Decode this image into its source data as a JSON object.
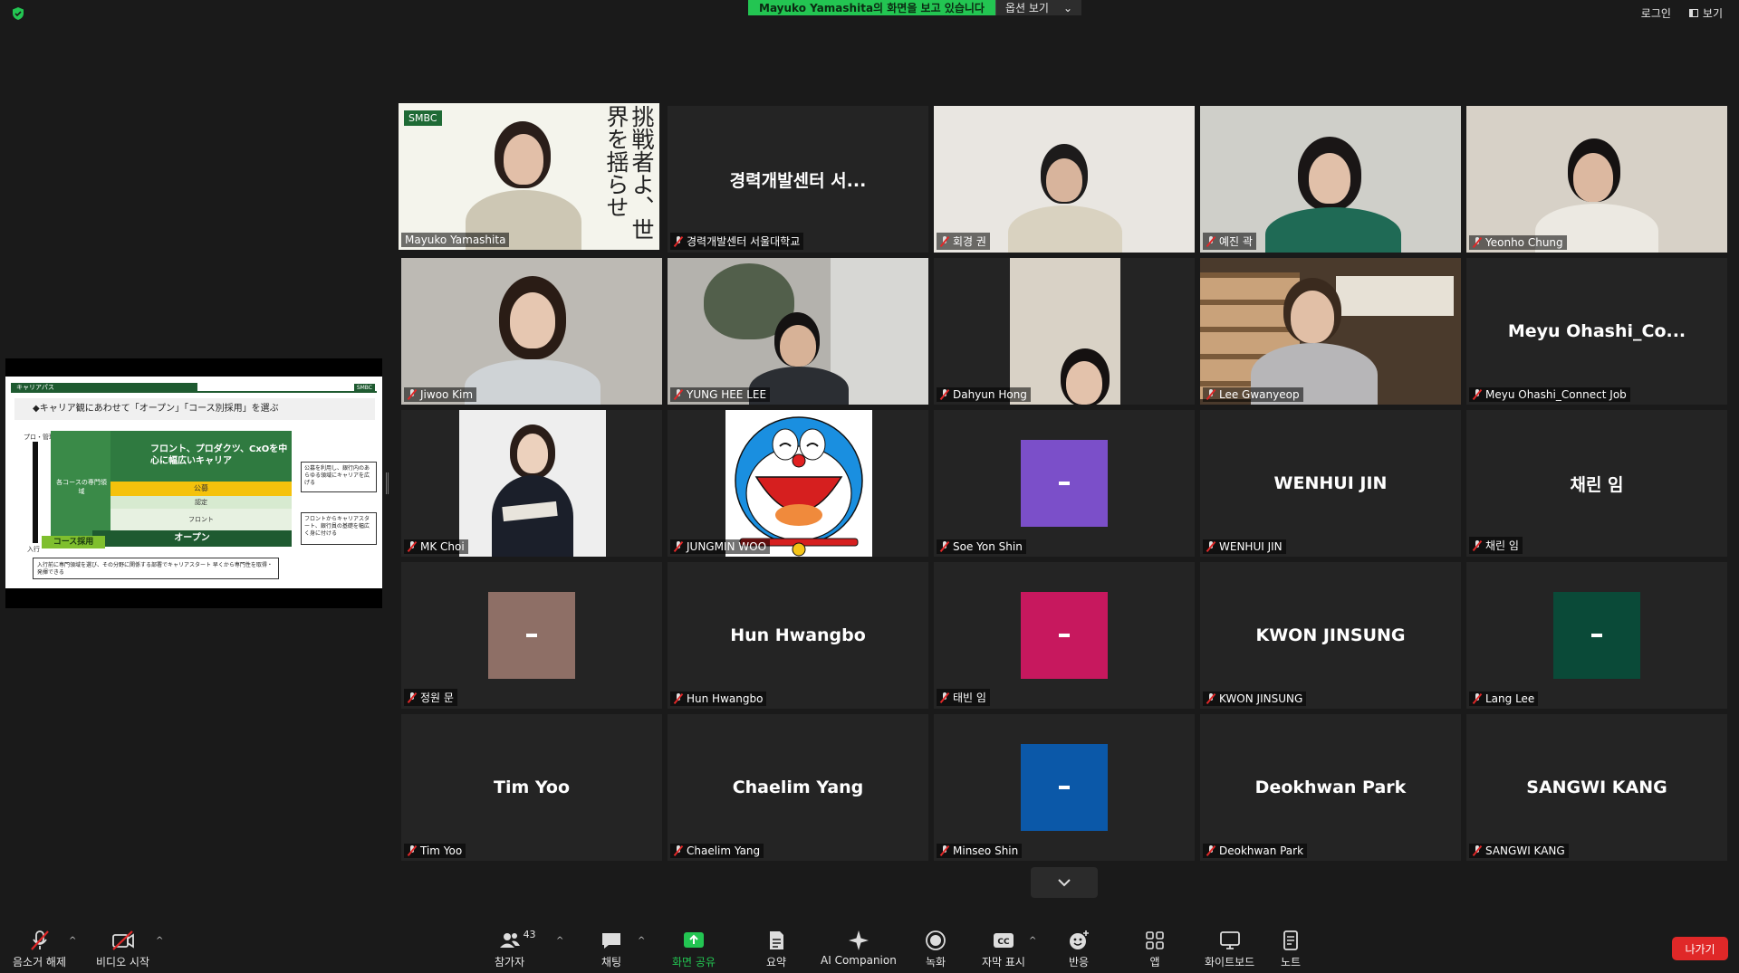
{
  "topbar": {
    "share_message": "Mayuko Yamashita의 화면을 보고 있습니다",
    "view_options": "옵션 보기",
    "login": "로그인",
    "view": "보기"
  },
  "shared_slide": {
    "section": "キャリアパス",
    "logo": "SMBC",
    "heading": "◆キャリア観にあわせて「オープン」「コース別採用」を選ぶ",
    "axis_top": "プロ・管理職",
    "axis_bottom": "入行",
    "course_specialist": "各コースの専門領域",
    "main_career": "フロント、プロダクツ、CxOを中心に幅広いキャリア",
    "band_public": "公募",
    "band_approval": "認定",
    "band_front": "フロント",
    "band_open": "オープン",
    "band_course": "コース採用",
    "note_public": "公募を利用し、銀行内のあらゆる領域にキャリアを広げる",
    "note_front": "フロントからキャリアスタート、銀行員の基礎を幅広く身に付ける",
    "note_course": "入行前に専門領域を選び、その分野に関係する部署でキャリアスタート 早くから専門性を取得・発揮できる"
  },
  "speaker_tile": {
    "name": "Mayuko Yamashita",
    "logo": "SMBC",
    "vertical_text": "挑戦者よ、世界を揺らせ"
  },
  "participants": [
    {
      "name": "경력개발센터 서울대학교",
      "display": "경력개발센터 서..."
    },
    {
      "name": "회경 권"
    },
    {
      "name": "예진 곽"
    },
    {
      "name": "Yeonho Chung"
    },
    {
      "name": "Jiwoo Kim"
    },
    {
      "name": "YUNG HEE LEE"
    },
    {
      "name": "Dahyun Hong"
    },
    {
      "name": "Lee Gwanyeop"
    },
    {
      "name": "Meyu Ohashi_Connect Job",
      "display": "Meyu  Ohashi_Co..."
    },
    {
      "name": "MK Choi"
    },
    {
      "name": "JUNGMIN WOO"
    },
    {
      "name": "Soe Yon Shin",
      "color": "#7b4fc9"
    },
    {
      "name": "WENHUI JIN",
      "display": "WENHUI JIN"
    },
    {
      "name": "채린 임",
      "display": "채린 임"
    },
    {
      "name": "정원 문",
      "color": "#8e6f66"
    },
    {
      "name": "Hun Hwangbo",
      "display": "Hun Hwangbo"
    },
    {
      "name": "태빈 임",
      "color": "#c7185e"
    },
    {
      "name": "KWON JINSUNG",
      "display": "KWON JINSUNG"
    },
    {
      "name": "Lang Lee",
      "color": "#0a4a38"
    },
    {
      "name": "Tim Yoo",
      "display": "Tim Yoo"
    },
    {
      "name": "Chaelim Yang",
      "display": "Chaelim Yang"
    },
    {
      "name": "Minseo Shin",
      "color": "#0b58a8"
    },
    {
      "name": "Deokhwan Park",
      "display": "Deokhwan Park"
    },
    {
      "name": "SANGWI KANG",
      "display": "SANGWI KANG"
    }
  ],
  "toolbar": {
    "unmute": "음소거 해제",
    "start_video": "비디오 시작",
    "participants": "참가자",
    "participants_count": "43",
    "chat": "채팅",
    "share_screen": "화면 공유",
    "summary": "요약",
    "ai_companion": "AI Companion",
    "record": "녹화",
    "captions": "자막 표시",
    "reactions": "반응",
    "apps": "앱",
    "whiteboard": "화이트보드",
    "notes": "노트",
    "leave": "나가기"
  },
  "colors": {
    "share_green": "#23c552",
    "active_speaker": "#d4f000",
    "leave_red": "#e02828",
    "tile_bg": "#242424"
  }
}
